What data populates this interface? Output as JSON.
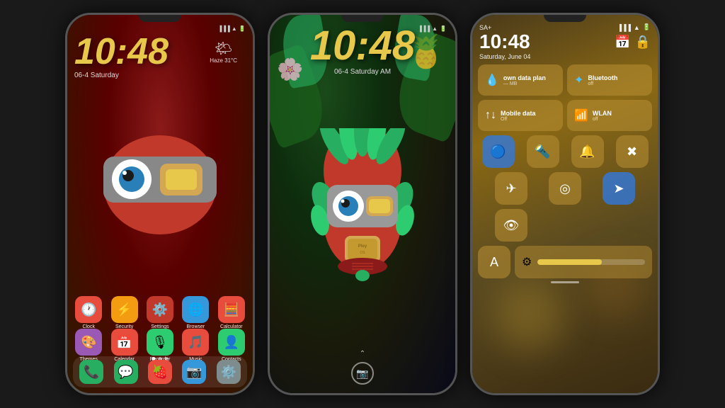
{
  "background_color": "#1a1a1a",
  "phones": [
    {
      "id": "phone1",
      "type": "home_screen",
      "status_bar": {
        "time": "",
        "signal": "▐▐▐",
        "wifi": "▲",
        "battery": "▮▮▮"
      },
      "clock": {
        "time": "10:48",
        "date": "06-4 Saturday",
        "weather": "Haze 31°C"
      },
      "apps_row1": [
        {
          "icon": "🕐",
          "label": "Clock",
          "bg": "#e74c3c"
        },
        {
          "icon": "⚡",
          "label": "Security",
          "bg": "#f39c12"
        },
        {
          "icon": "⚙️",
          "label": "Settings",
          "bg": "#e74c3c"
        },
        {
          "icon": "🌐",
          "label": "Browser",
          "bg": "#3498db"
        },
        {
          "icon": "🧮",
          "label": "Calculator",
          "bg": "#e74c3c"
        }
      ],
      "apps_row2": [
        {
          "icon": "🎨",
          "label": "Themes",
          "bg": "#9b59b6"
        },
        {
          "icon": "📅",
          "label": "Calendar",
          "bg": "#e74c3c"
        },
        {
          "icon": "🎙",
          "label": "Recorder",
          "bg": "#2ecc71"
        },
        {
          "icon": "🎵",
          "label": "Music",
          "bg": "#e74c3c"
        },
        {
          "icon": "👤",
          "label": "Contacts",
          "bg": "#2ecc71"
        }
      ],
      "dock_apps": [
        {
          "icon": "📞",
          "label": "",
          "bg": "#27ae60"
        },
        {
          "icon": "💬",
          "label": "",
          "bg": "#27ae60"
        },
        {
          "icon": "🍓",
          "label": "",
          "bg": "#e74c3c"
        },
        {
          "icon": "📷",
          "label": "",
          "bg": "#3498db"
        },
        {
          "icon": "⚙️",
          "label": "",
          "bg": "#7f8c8d"
        }
      ]
    },
    {
      "id": "phone2",
      "type": "lock_screen",
      "status_bar": {
        "signal": "▐▐▐",
        "wifi": "▲",
        "battery": "▮▮▮"
      },
      "clock": {
        "time": "10:48",
        "date": "06-4 Saturday AM"
      },
      "bottom": {
        "camera_icon": "📷"
      }
    },
    {
      "id": "phone3",
      "type": "control_center",
      "status_bar": {
        "label": "SA+",
        "signal": "▐▐▐",
        "wifi": "▲",
        "battery": "▮▮▮"
      },
      "clock": {
        "time": "10:48",
        "date": "Saturday, June 04"
      },
      "date_icons": {
        "calendar": "📅",
        "lock": "🔒"
      },
      "control_tiles": [
        {
          "id": "data_plan",
          "icon": "💧",
          "title": "own data plan",
          "sub": "— MB",
          "active": false
        },
        {
          "id": "bluetooth",
          "icon": "✦",
          "title": "Bluetooth",
          "sub": "off",
          "active": false
        },
        {
          "id": "mobile_data",
          "icon": "↑↓",
          "title": "Mobile data",
          "sub": "Off",
          "active": false
        },
        {
          "id": "wlan",
          "icon": "📶",
          "title": "WLAN",
          "sub": "off",
          "active": false
        }
      ],
      "quick_buttons_row1": [
        {
          "icon": "🔵",
          "label": "flashlight",
          "active": true
        },
        {
          "icon": "🔦",
          "label": "torch",
          "active": false
        },
        {
          "icon": "🔔",
          "label": "bell",
          "active": false
        },
        {
          "icon": "✖",
          "label": "close",
          "active": false
        }
      ],
      "quick_buttons_row2": [
        {
          "icon": "✈",
          "label": "airplane",
          "active": false
        },
        {
          "icon": "◎",
          "label": "target",
          "active": false
        },
        {
          "icon": "➤",
          "label": "location",
          "active": true
        },
        {
          "icon": "👁",
          "label": "eye",
          "active": false
        }
      ],
      "bottom": {
        "text_btn": "A",
        "brightness_icon": "⚙",
        "brightness_level": 60
      }
    }
  ]
}
